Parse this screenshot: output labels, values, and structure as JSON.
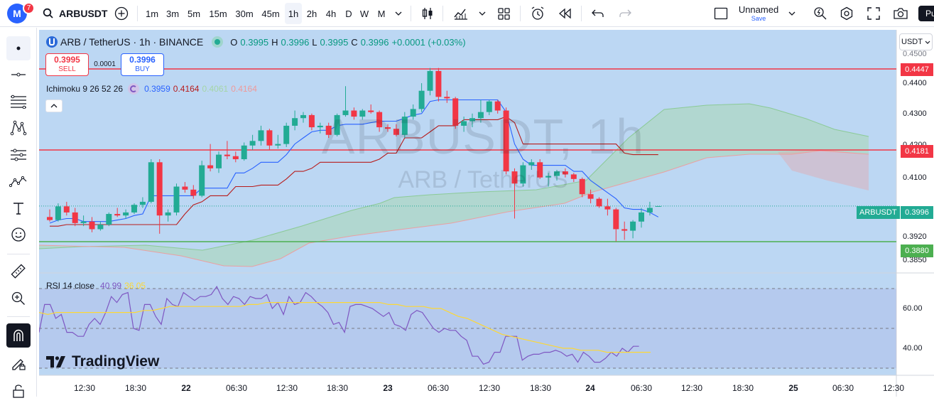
{
  "topbar": {
    "avatar_letter": "M",
    "notification_count": "7",
    "symbol": "ARBUSDT",
    "intervals": [
      "1m",
      "3m",
      "5m",
      "15m",
      "30m",
      "45m",
      "1h",
      "2h",
      "4h",
      "D",
      "W",
      "M"
    ],
    "active_interval": "1h",
    "layout_name": "Unnamed",
    "save_label": "Save",
    "right_edge_label": "Pu"
  },
  "legend": {
    "symbol_line": "ARB / TetherUS · 1h · BINANCE",
    "open_label": "O",
    "open": "0.3995",
    "high_label": "H",
    "high": "0.3996",
    "low_label": "L",
    "low": "0.3995",
    "close_label": "C",
    "close": "0.3996",
    "change": "+0.0001 (+0.03%)",
    "sell_price": "0.3995",
    "sell_label": "SELL",
    "spread": "0.0001",
    "buy_price": "0.3996",
    "buy_label": "BUY",
    "ichimoku_label": "Ichimoku 9 26 52 26",
    "ichimoku_values": [
      "0.3959",
      "0.4164",
      "0.4061",
      "0.4164"
    ],
    "ichimoku_colors": [
      "#2962ff",
      "#b71c1c",
      "#a5d6a7",
      "#ef9a9a"
    ],
    "rsi_label": "RSI 14 close",
    "rsi_value": "40.99",
    "rsi_ma_value": "36.05"
  },
  "watermark": {
    "main": "ARBUSDT, 1h",
    "sub": "ARB / TetherUS"
  },
  "price_scale": {
    "currency": "USDT",
    "labels": [
      "0.4400",
      "0.4300",
      "0.4200",
      "0.4100",
      "0.3920",
      "0.3850"
    ],
    "top_partial": "0.4500",
    "tags": [
      {
        "value": "0.4447",
        "color": "#f23645"
      },
      {
        "value": "0.4181",
        "color": "#f23645"
      },
      {
        "value": "0.3996",
        "color": "#22ab94"
      },
      {
        "value": "0.3880",
        "color": "#4caf50"
      }
    ],
    "symbol_tag": "ARBUSDT"
  },
  "rsi_scale": {
    "labels": [
      "60.00",
      "40.00"
    ]
  },
  "time_scale": {
    "labels": [
      {
        "text": "12:30",
        "bold": false
      },
      {
        "text": "18:30",
        "bold": false
      },
      {
        "text": "22",
        "bold": true
      },
      {
        "text": "06:30",
        "bold": false
      },
      {
        "text": "12:30",
        "bold": false
      },
      {
        "text": "18:30",
        "bold": false
      },
      {
        "text": "23",
        "bold": true
      },
      {
        "text": "06:30",
        "bold": false
      },
      {
        "text": "12:30",
        "bold": false
      },
      {
        "text": "18:30",
        "bold": false
      },
      {
        "text": "24",
        "bold": true
      },
      {
        "text": "06:30",
        "bold": false
      },
      {
        "text": "12:30",
        "bold": false
      },
      {
        "text": "18:30",
        "bold": false
      },
      {
        "text": "25",
        "bold": true
      },
      {
        "text": "06:30",
        "bold": false
      },
      {
        "text": "12:30",
        "bold": false
      }
    ]
  },
  "logo_text": "TradingView",
  "colors": {
    "up": "#22ab94",
    "down": "#f23645",
    "chart_bg": "#bcd7f3",
    "hline_red": "#f23645",
    "hline_green": "#4caf50"
  },
  "chart_data": {
    "type": "candlestick",
    "symbol": "ARBUSDT",
    "interval": "1h",
    "horizontal_lines": [
      0.4447,
      0.4181,
      0.388
    ],
    "last_price": 0.3996,
    "candles": [
      [
        0.396,
        0.3985,
        0.3945,
        0.395
      ],
      [
        0.395,
        0.4005,
        0.3945,
        0.3995
      ],
      [
        0.3995,
        0.401,
        0.3965,
        0.3975
      ],
      [
        0.3975,
        0.399,
        0.393,
        0.394
      ],
      [
        0.394,
        0.3965,
        0.393,
        0.3945
      ],
      [
        0.3945,
        0.396,
        0.391,
        0.392
      ],
      [
        0.392,
        0.3945,
        0.3915,
        0.3935
      ],
      [
        0.3935,
        0.3975,
        0.393,
        0.397
      ],
      [
        0.397,
        0.399,
        0.396,
        0.3965
      ],
      [
        0.3965,
        0.3985,
        0.3955,
        0.3975
      ],
      [
        0.3975,
        0.4005,
        0.397,
        0.4
      ],
      [
        0.4,
        0.4025,
        0.399,
        0.401
      ],
      [
        0.401,
        0.415,
        0.4005,
        0.414
      ],
      [
        0.414,
        0.415,
        0.3905,
        0.3965
      ],
      [
        0.3965,
        0.3985,
        0.3945,
        0.3975
      ],
      [
        0.3975,
        0.407,
        0.3965,
        0.406
      ],
      [
        0.406,
        0.4075,
        0.404,
        0.405
      ],
      [
        0.405,
        0.4065,
        0.402,
        0.403
      ],
      [
        0.403,
        0.4145,
        0.4025,
        0.413
      ],
      [
        0.413,
        0.42,
        0.411,
        0.412
      ],
      [
        0.412,
        0.4175,
        0.4105,
        0.4165
      ],
      [
        0.4165,
        0.421,
        0.415,
        0.416
      ],
      [
        0.416,
        0.4175,
        0.414,
        0.415
      ],
      [
        0.415,
        0.4205,
        0.4145,
        0.4195
      ],
      [
        0.4195,
        0.423,
        0.418,
        0.421
      ],
      [
        0.421,
        0.426,
        0.4195,
        0.4245
      ],
      [
        0.4245,
        0.425,
        0.418,
        0.4195
      ],
      [
        0.4195,
        0.423,
        0.4185,
        0.42
      ],
      [
        0.42,
        0.427,
        0.419,
        0.426
      ],
      [
        0.426,
        0.431,
        0.4245,
        0.4285
      ],
      [
        0.4285,
        0.4305,
        0.427,
        0.4295
      ],
      [
        0.4295,
        0.43,
        0.4245,
        0.4255
      ],
      [
        0.4255,
        0.427,
        0.4235,
        0.426
      ],
      [
        0.426,
        0.427,
        0.422,
        0.423
      ],
      [
        0.423,
        0.43,
        0.4225,
        0.4295
      ],
      [
        0.4295,
        0.439,
        0.429,
        0.431
      ],
      [
        0.431,
        0.432,
        0.428,
        0.429
      ],
      [
        0.429,
        0.4315,
        0.428,
        0.431
      ],
      [
        0.431,
        0.433,
        0.43,
        0.4305
      ],
      [
        0.4305,
        0.431,
        0.424,
        0.4255
      ],
      [
        0.4255,
        0.4265,
        0.424,
        0.425
      ],
      [
        0.425,
        0.4265,
        0.4225,
        0.423
      ],
      [
        0.423,
        0.4305,
        0.422,
        0.429
      ],
      [
        0.429,
        0.433,
        0.428,
        0.4315
      ],
      [
        0.4315,
        0.44,
        0.4305,
        0.4375
      ],
      [
        0.4375,
        0.445,
        0.436,
        0.444
      ],
      [
        0.444,
        0.445,
        0.434,
        0.4355
      ],
      [
        0.4355,
        0.4375,
        0.4335,
        0.435
      ],
      [
        0.435,
        0.4355,
        0.425,
        0.426
      ],
      [
        0.426,
        0.429,
        0.424,
        0.4275
      ],
      [
        0.4275,
        0.43,
        0.4255,
        0.4285
      ],
      [
        0.4285,
        0.4345,
        0.427,
        0.4305
      ],
      [
        0.4305,
        0.4345,
        0.4295,
        0.434
      ],
      [
        0.434,
        0.4345,
        0.43,
        0.431
      ],
      [
        0.431,
        0.432,
        0.41,
        0.411
      ],
      [
        0.411,
        0.412,
        0.3955,
        0.407
      ],
      [
        0.407,
        0.414,
        0.406,
        0.413
      ],
      [
        0.413,
        0.415,
        0.4115,
        0.414
      ],
      [
        0.414,
        0.415,
        0.4085,
        0.409
      ],
      [
        0.409,
        0.4105,
        0.406,
        0.4095
      ],
      [
        0.4095,
        0.4115,
        0.408,
        0.411
      ],
      [
        0.411,
        0.412,
        0.409,
        0.41
      ],
      [
        0.41,
        0.4105,
        0.4075,
        0.4085
      ],
      [
        0.4085,
        0.409,
        0.4025,
        0.4035
      ],
      [
        0.4035,
        0.405,
        0.4005,
        0.402
      ],
      [
        0.402,
        0.4025,
        0.399,
        0.3995
      ],
      [
        0.3995,
        0.402,
        0.3965,
        0.3985
      ],
      [
        0.3985,
        0.399,
        0.388,
        0.392
      ],
      [
        0.392,
        0.3945,
        0.3885,
        0.3915
      ],
      [
        0.3915,
        0.395,
        0.389,
        0.3945
      ],
      [
        0.3945,
        0.399,
        0.3925,
        0.3975
      ],
      [
        0.3975,
        0.401,
        0.3965,
        0.399
      ],
      [
        0.3995,
        0.3996,
        0.3995,
        0.3996
      ]
    ],
    "tenkan": [
      0.394,
      0.395,
      0.3955,
      0.3955,
      0.3945,
      0.3945,
      0.3945,
      0.3945,
      0.395,
      0.3955,
      0.3965,
      0.397,
      0.403,
      0.403,
      0.403,
      0.403,
      0.403,
      0.403,
      0.4055,
      0.4055,
      0.4055,
      0.4055,
      0.4105,
      0.4105,
      0.412,
      0.414,
      0.414,
      0.414,
      0.4165,
      0.42,
      0.422,
      0.424,
      0.4245,
      0.4245,
      0.426,
      0.4265,
      0.4265,
      0.4265,
      0.427,
      0.4275,
      0.4275,
      0.4275,
      0.4285,
      0.4295,
      0.43,
      0.434,
      0.4345,
      0.4345,
      0.4345,
      0.4345,
      0.4345,
      0.4345,
      0.4345,
      0.4345,
      0.4305,
      0.42,
      0.415,
      0.413,
      0.413,
      0.413,
      0.413,
      0.413,
      0.411,
      0.411,
      0.408,
      0.406,
      0.404,
      0.402,
      0.399,
      0.3985,
      0.3985,
      0.3975,
      0.396
    ],
    "kijun": [
      0.393,
      0.393,
      0.3935,
      0.3935,
      0.3935,
      0.3935,
      0.3935,
      0.3935,
      0.3935,
      0.3935,
      0.3935,
      0.3935,
      0.3935,
      0.3935,
      0.3935,
      0.3935,
      0.397,
      0.4,
      0.401,
      0.403,
      0.403,
      0.403,
      0.406,
      0.406,
      0.406,
      0.4065,
      0.4065,
      0.4065,
      0.4085,
      0.411,
      0.411,
      0.412,
      0.414,
      0.414,
      0.414,
      0.414,
      0.414,
      0.414,
      0.414,
      0.415,
      0.417,
      0.417,
      0.422,
      0.422,
      0.422,
      0.424,
      0.426,
      0.426,
      0.426,
      0.428,
      0.428,
      0.428,
      0.428,
      0.428,
      0.429,
      0.427,
      0.42,
      0.42,
      0.42,
      0.42,
      0.42,
      0.42,
      0.42,
      0.42,
      0.42,
      0.42,
      0.42,
      0.42,
      0.417,
      0.4165,
      0.4165,
      0.4165,
      0.4165
    ],
    "rsi": [
      48,
      62,
      62,
      55,
      57,
      48,
      48,
      46,
      46,
      52,
      55,
      52,
      58,
      66,
      63,
      67,
      68,
      50,
      49,
      62,
      62,
      56,
      52,
      65,
      62,
      61,
      68,
      66,
      64,
      66,
      66,
      67,
      71,
      65,
      62,
      66,
      65,
      62,
      66,
      65,
      65,
      67,
      60,
      63,
      57,
      66,
      62,
      63,
      68,
      66,
      63,
      61,
      58,
      52,
      53,
      48,
      61,
      62,
      62,
      61,
      60,
      58,
      56,
      58,
      52,
      51,
      49,
      57,
      59,
      58,
      54,
      50,
      48,
      50,
      49,
      49,
      46,
      44,
      36,
      36,
      32,
      33,
      38,
      38,
      46,
      46,
      46,
      34,
      36,
      37,
      37,
      38,
      38,
      39,
      38,
      36,
      37,
      33,
      38,
      36,
      33,
      33,
      35,
      38,
      36,
      40,
      38,
      41,
      41
    ],
    "rsi_ma": [
      58,
      57,
      58,
      58,
      58,
      58,
      58,
      58,
      58,
      58,
      58,
      58,
      59,
      59,
      60,
      61,
      61,
      61,
      61,
      61,
      61,
      61,
      61,
      61,
      62,
      62,
      63,
      63,
      63,
      63,
      63,
      63,
      63,
      63,
      63,
      63,
      63,
      63,
      63,
      63,
      62,
      62,
      61,
      61,
      61,
      60,
      60,
      58,
      56,
      55,
      53,
      51,
      49,
      47,
      46,
      45,
      44,
      43,
      42,
      41,
      40,
      40,
      39,
      39,
      39,
      38,
      38,
      38,
      38,
      38,
      38
    ]
  }
}
